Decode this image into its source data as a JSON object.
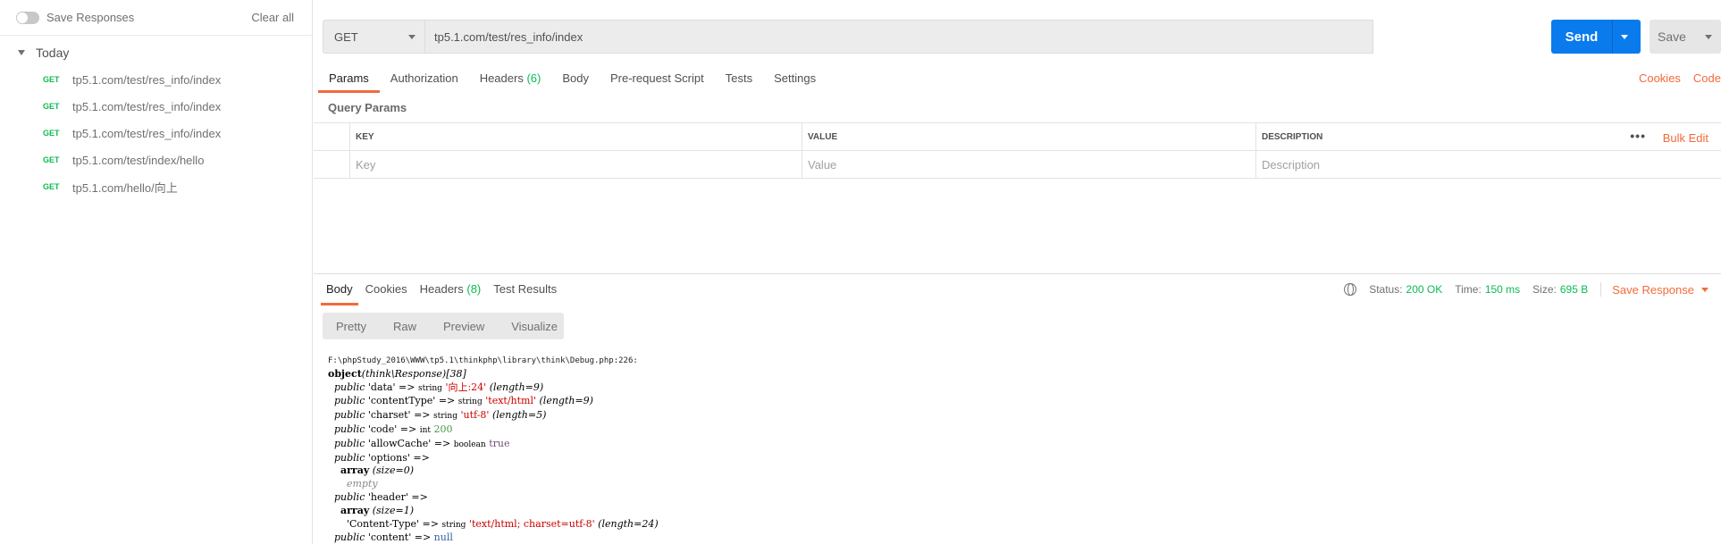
{
  "sidebar": {
    "save_responses_label": "Save Responses",
    "clear_all": "Clear all",
    "group_label": "Today",
    "history": [
      {
        "method": "GET",
        "url": "tp5.1.com/test/res_info/index"
      },
      {
        "method": "GET",
        "url": "tp5.1.com/test/res_info/index"
      },
      {
        "method": "GET",
        "url": "tp5.1.com/test/res_info/index"
      },
      {
        "method": "GET",
        "url": "tp5.1.com/test/index/hello"
      },
      {
        "method": "GET",
        "url": "tp5.1.com/hello/向上"
      }
    ]
  },
  "request": {
    "method": "GET",
    "url": "tp5.1.com/test/res_info/index",
    "send_label": "Send",
    "save_label": "Save"
  },
  "req_tabs": {
    "params": "Params",
    "authorization": "Authorization",
    "headers": "Headers",
    "headers_count": "(6)",
    "body": "Body",
    "prerequest": "Pre-request Script",
    "tests": "Tests",
    "settings": "Settings",
    "cookies": "Cookies",
    "code": "Code"
  },
  "query_params": {
    "title": "Query Params",
    "col_key": "KEY",
    "col_value": "VALUE",
    "col_description": "DESCRIPTION",
    "more": "•••",
    "bulk_edit": "Bulk Edit",
    "ph_key": "Key",
    "ph_value": "Value",
    "ph_description": "Description"
  },
  "response_tabs": {
    "body": "Body",
    "cookies": "Cookies",
    "headers": "Headers",
    "headers_count": "(8)",
    "test_results": "Test Results"
  },
  "status": {
    "status_label": "Status:",
    "status_value": "200 OK",
    "time_label": "Time:",
    "time_value": "150 ms",
    "size_label": "Size:",
    "size_value": "695 B",
    "save_response": "Save Response"
  },
  "views": {
    "pretty": "Pretty",
    "raw": "Raw",
    "preview": "Preview",
    "visualize": "Visualize"
  },
  "output": {
    "path": "F:\\phpStudy_2016\\WWW\\tp5.1\\thinkphp\\library\\think\\Debug.php:226:",
    "object_kw": "object",
    "class_name": "(think\\Response)",
    "object_id": "[38]",
    "public_kw": "public",
    "arrow": "=>",
    "data_key": "'data'",
    "data_type": "string",
    "data_val": "'向上:24'",
    "data_len": "(length=9)",
    "ct_key": "'contentType'",
    "ct_type": "string",
    "ct_val": "'text/html'",
    "ct_len": "(length=9)",
    "cs_key": "'charset'",
    "cs_type": "string",
    "cs_val": "'utf-8'",
    "cs_len": "(length=5)",
    "code_key": "'code'",
    "code_type": "int",
    "code_val": "200",
    "ac_key": "'allowCache'",
    "ac_type": "boolean",
    "ac_val": "true",
    "opt_key": "'options'",
    "array_kw": "array",
    "opt_size": "(size=0)",
    "empty": "empty",
    "hdr_key": "'header'",
    "hdr_size": "(size=1)",
    "hct_key": "'Content-Type'",
    "hct_type": "string",
    "hct_val": "'text/html; charset=utf-8'",
    "hct_len": "(length=24)",
    "content_key": "'content'",
    "content_val": "null"
  }
}
